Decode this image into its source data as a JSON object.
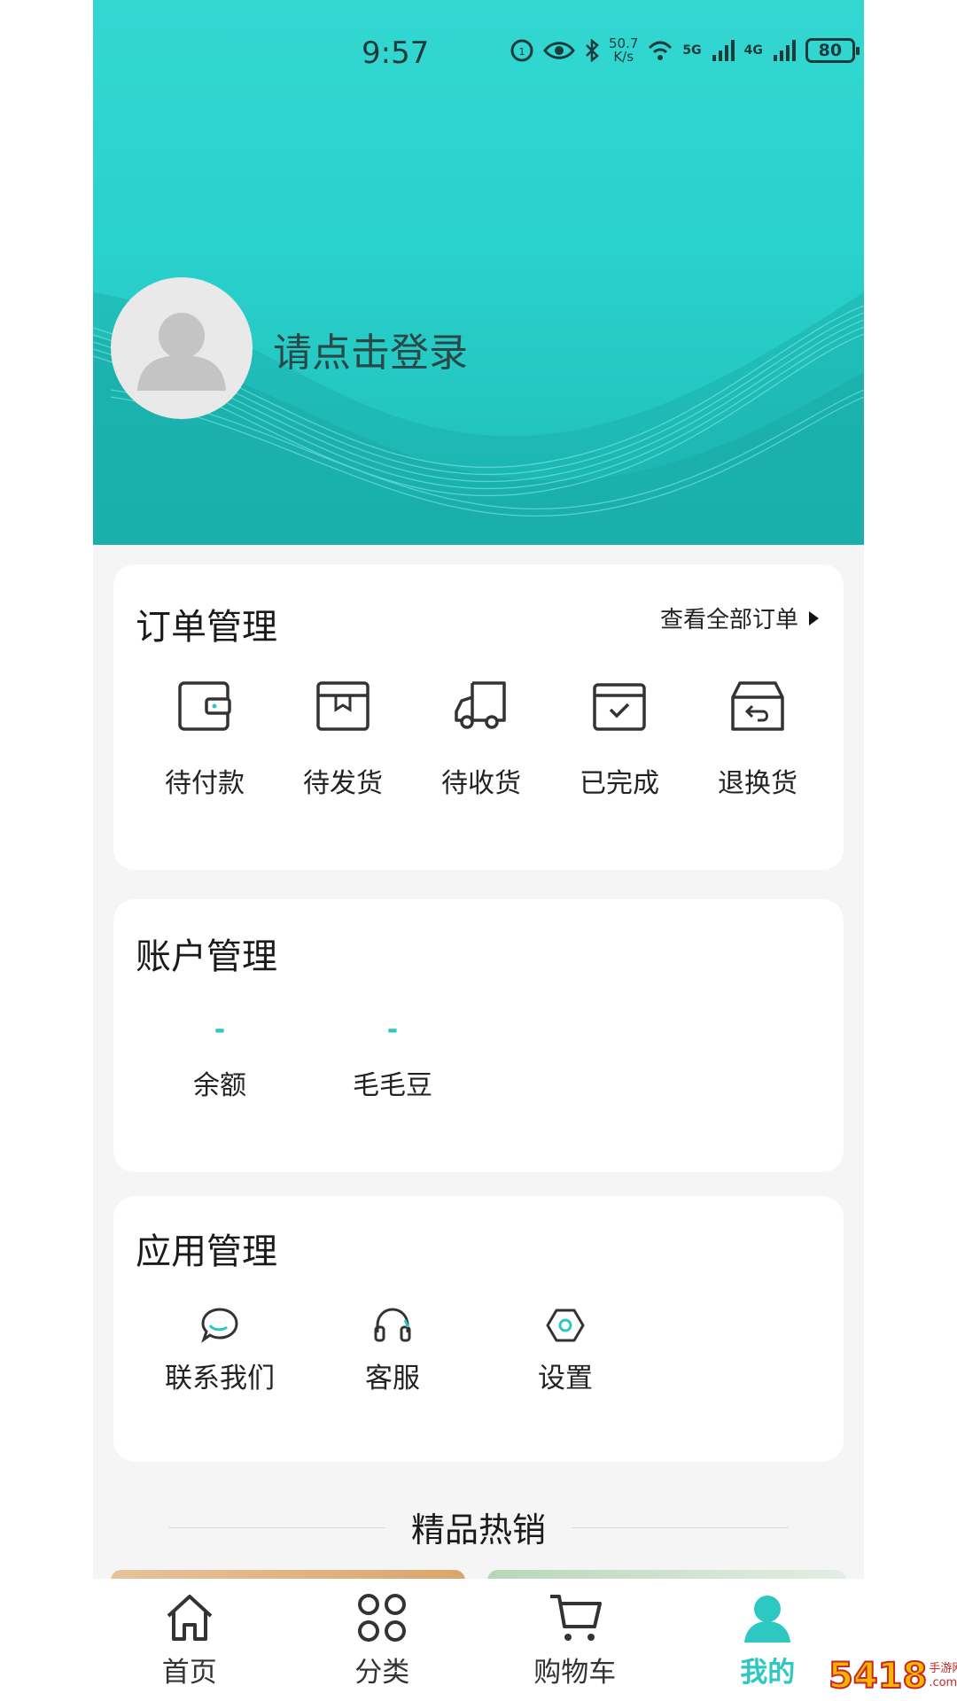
{
  "status_bar": {
    "time": "9:57",
    "speed_value": "50.7",
    "speed_unit": "K/s",
    "net_1": "5G",
    "net_2": "4G",
    "battery": "80"
  },
  "profile": {
    "login_prompt": "请点击登录"
  },
  "orders": {
    "title": "订单管理",
    "view_all": "查看全部订单",
    "items": [
      {
        "label": "待付款",
        "icon": "wallet-icon"
      },
      {
        "label": "待发货",
        "icon": "package-icon"
      },
      {
        "label": "待收货",
        "icon": "truck-icon"
      },
      {
        "label": "已完成",
        "icon": "calendar-check-icon"
      },
      {
        "label": "退换货",
        "icon": "return-box-icon"
      }
    ]
  },
  "account": {
    "title": "账户管理",
    "items": [
      {
        "value": "-",
        "label": "余额"
      },
      {
        "value": "-",
        "label": "毛毛豆"
      }
    ]
  },
  "apps": {
    "title": "应用管理",
    "items": [
      {
        "label": "联系我们",
        "icon": "chat-bubble-icon"
      },
      {
        "label": "客服",
        "icon": "headset-icon"
      },
      {
        "label": "设置",
        "icon": "settings-hexagon-icon"
      }
    ]
  },
  "hot_sales": {
    "title": "精品热销"
  },
  "tabbar": {
    "items": [
      {
        "label": "首页",
        "icon": "home-icon"
      },
      {
        "label": "分类",
        "icon": "category-icon"
      },
      {
        "label": "购物车",
        "icon": "cart-icon"
      },
      {
        "label": "我的",
        "icon": "user-icon",
        "active": true
      }
    ]
  },
  "watermark": {
    "text": "5418",
    "sub_1": "手游网",
    "sub_2": ".com.cn"
  },
  "colors": {
    "accent": "#2ec8c3",
    "header": "#2ad2cd",
    "background": "#f5f5f5"
  }
}
